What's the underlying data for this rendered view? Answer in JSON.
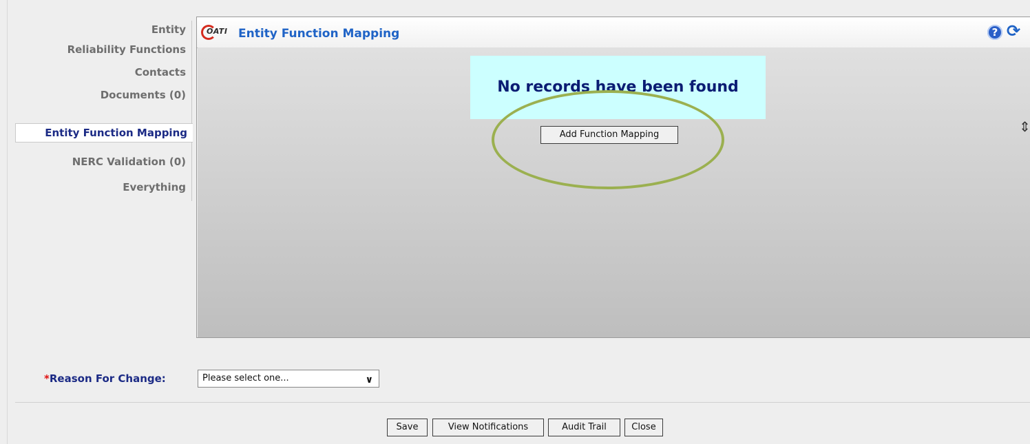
{
  "sidebar": {
    "items": [
      {
        "label": "Entity"
      },
      {
        "label": "Reliability Functions"
      },
      {
        "label": "Contacts"
      },
      {
        "label": "Documents (0)"
      },
      {
        "label": "Entity Function Mapping"
      },
      {
        "label": "NERC Validation (0)"
      },
      {
        "label": "Everything"
      }
    ],
    "active": "Entity Function Mapping"
  },
  "panel": {
    "logo_text": "OATI",
    "title": "Entity Function Mapping",
    "help_icon": "?",
    "refresh_icon": "⟳",
    "empty_message": "No records have been found",
    "add_button_label": "Add Function Mapping",
    "scroll_icon": "⇕"
  },
  "reason": {
    "required_mark": "*",
    "label": "Reason For Change:",
    "selected": "Please select one..."
  },
  "footer": {
    "save_label": "Save",
    "view_notifications_label": "View Notifications",
    "audit_trail_label": "Audit Trail",
    "close_label": "Close"
  },
  "colors": {
    "title_blue": "#1f63c6",
    "nav_active": "#1b2a85",
    "empty_bg": "#ccffff",
    "highlight_oval": "#9bb050"
  }
}
